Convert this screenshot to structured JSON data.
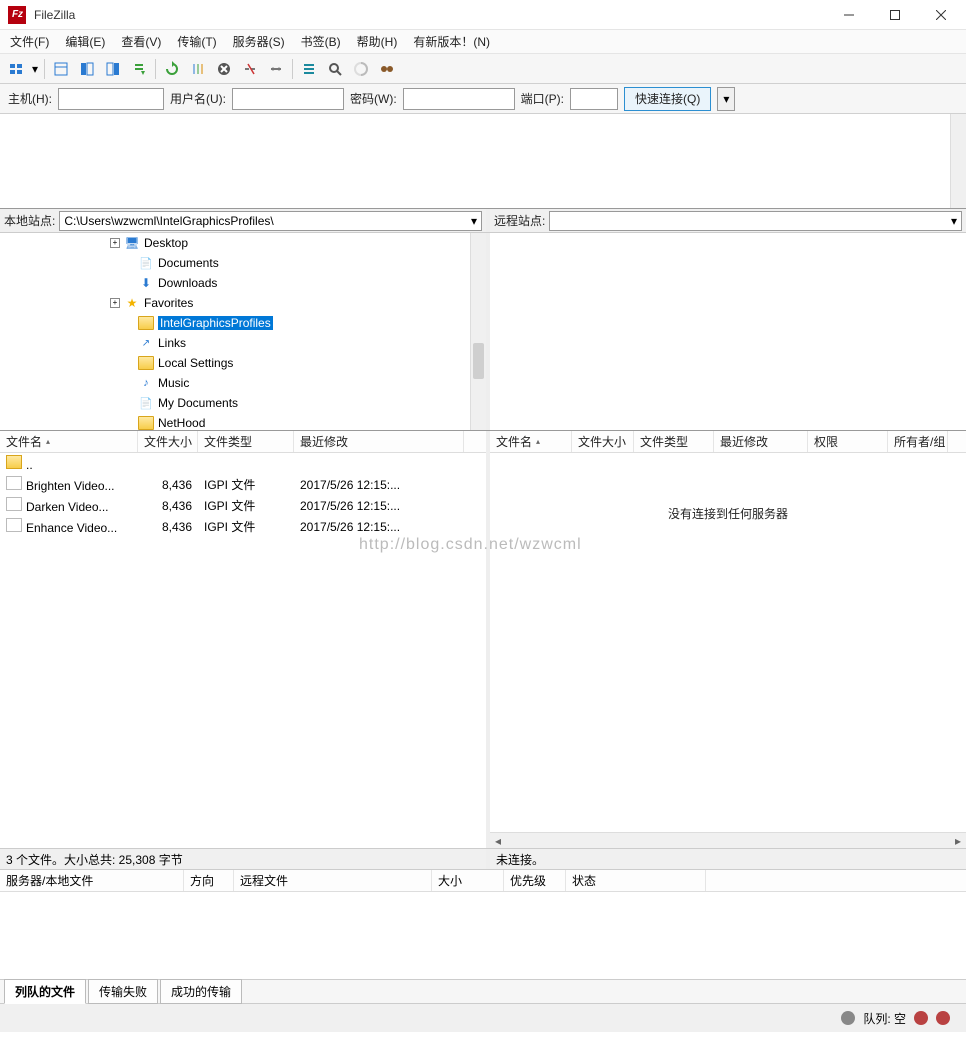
{
  "title": "FileZilla",
  "menu": [
    "文件(F)",
    "编辑(E)",
    "查看(V)",
    "传输(T)",
    "服务器(S)",
    "书签(B)",
    "帮助(H)",
    "有新版本！(N)"
  ],
  "quick": {
    "host_label": "主机(H):",
    "user_label": "用户名(U):",
    "pass_label": "密码(W):",
    "port_label": "端口(P):",
    "btn": "快速连接(Q)"
  },
  "paths": {
    "local_label": "本地站点:",
    "local_value": "C:\\Users\\wzwcml\\IntelGraphicsProfiles\\",
    "remote_label": "远程站点:",
    "remote_value": ""
  },
  "localTree": [
    {
      "indent": 110,
      "exp": "+",
      "icon": "desktop",
      "label": "Desktop"
    },
    {
      "indent": 124,
      "icon": "doc",
      "label": "Documents"
    },
    {
      "indent": 124,
      "icon": "dl",
      "label": "Downloads"
    },
    {
      "indent": 110,
      "exp": "+",
      "icon": "fav",
      "label": "Favorites"
    },
    {
      "indent": 124,
      "icon": "folder",
      "label": "IntelGraphicsProfiles",
      "selected": true
    },
    {
      "indent": 124,
      "icon": "link",
      "label": "Links"
    },
    {
      "indent": 124,
      "icon": "folder",
      "label": "Local Settings"
    },
    {
      "indent": 124,
      "icon": "music",
      "label": "Music"
    },
    {
      "indent": 124,
      "icon": "doc",
      "label": "My Documents"
    },
    {
      "indent": 124,
      "icon": "folder",
      "label": "NetHood"
    }
  ],
  "localCols": [
    {
      "label": "文件名",
      "w": 138,
      "sort": "asc"
    },
    {
      "label": "文件大小",
      "w": 60
    },
    {
      "label": "文件类型",
      "w": 96
    },
    {
      "label": "最近修改",
      "w": 170
    }
  ],
  "localRows": [
    {
      "name": "..",
      "up": true
    },
    {
      "name": "Brighten Video...",
      "size": "8,436",
      "type": "IGPI 文件",
      "mod": "2017/5/26 12:15:..."
    },
    {
      "name": "Darken Video...",
      "size": "8,436",
      "type": "IGPI 文件",
      "mod": "2017/5/26 12:15:..."
    },
    {
      "name": "Enhance Video...",
      "size": "8,436",
      "type": "IGPI 文件",
      "mod": "2017/5/26 12:15:..."
    }
  ],
  "remoteCols": [
    {
      "label": "文件名",
      "w": 82,
      "sort": "asc"
    },
    {
      "label": "文件大小",
      "w": 62
    },
    {
      "label": "文件类型",
      "w": 80
    },
    {
      "label": "最近修改",
      "w": 94
    },
    {
      "label": "权限",
      "w": 80
    },
    {
      "label": "所有者/组",
      "w": 60
    }
  ],
  "remoteEmpty": "没有连接到任何服务器",
  "localStatus": "3 个文件。大小总共: 25,308 字节",
  "remoteStatus": "未连接。",
  "queueCols": [
    {
      "label": "服务器/本地文件",
      "w": 184
    },
    {
      "label": "方向",
      "w": 50
    },
    {
      "label": "远程文件",
      "w": 198
    },
    {
      "label": "大小",
      "w": 72
    },
    {
      "label": "优先级",
      "w": 62
    },
    {
      "label": "状态",
      "w": 140
    }
  ],
  "queueTabs": [
    "列队的文件",
    "传输失败",
    "成功的传输"
  ],
  "queueLabel": "队列: 空",
  "watermark": "http://blog.csdn.net/wzwcml"
}
